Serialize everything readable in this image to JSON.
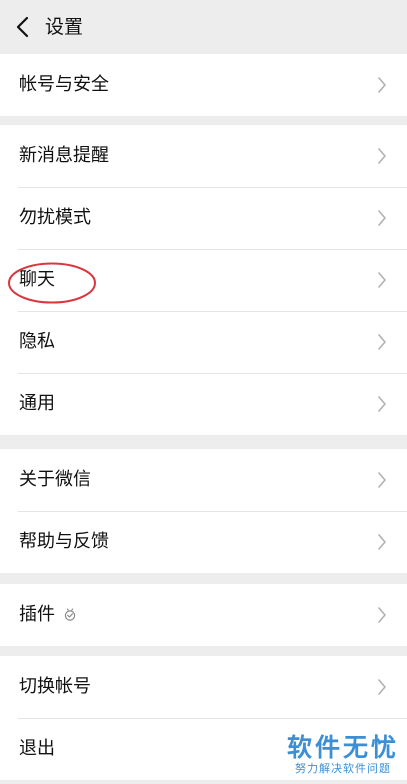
{
  "header": {
    "title": "设置",
    "back_icon": "chevron-left-icon"
  },
  "groups": [
    {
      "items": [
        {
          "label": "帐号与安全"
        }
      ]
    },
    {
      "items": [
        {
          "label": "新消息提醒"
        },
        {
          "label": "勿扰模式"
        },
        {
          "label": "聊天"
        },
        {
          "label": "隐私"
        },
        {
          "label": "通用"
        }
      ]
    },
    {
      "items": [
        {
          "label": "关于微信"
        },
        {
          "label": "帮助与反馈"
        }
      ]
    },
    {
      "items": [
        {
          "label": "插件",
          "icon": "plugin-icon"
        }
      ]
    },
    {
      "items": [
        {
          "label": "切换帐号"
        },
        {
          "label": "退出"
        }
      ]
    }
  ],
  "annotation": {
    "highlight_color": "#d9363e"
  },
  "watermark": {
    "title": "软件无忧",
    "subtitle": "努力解决软件问题",
    "color": "#3a8fd6"
  }
}
